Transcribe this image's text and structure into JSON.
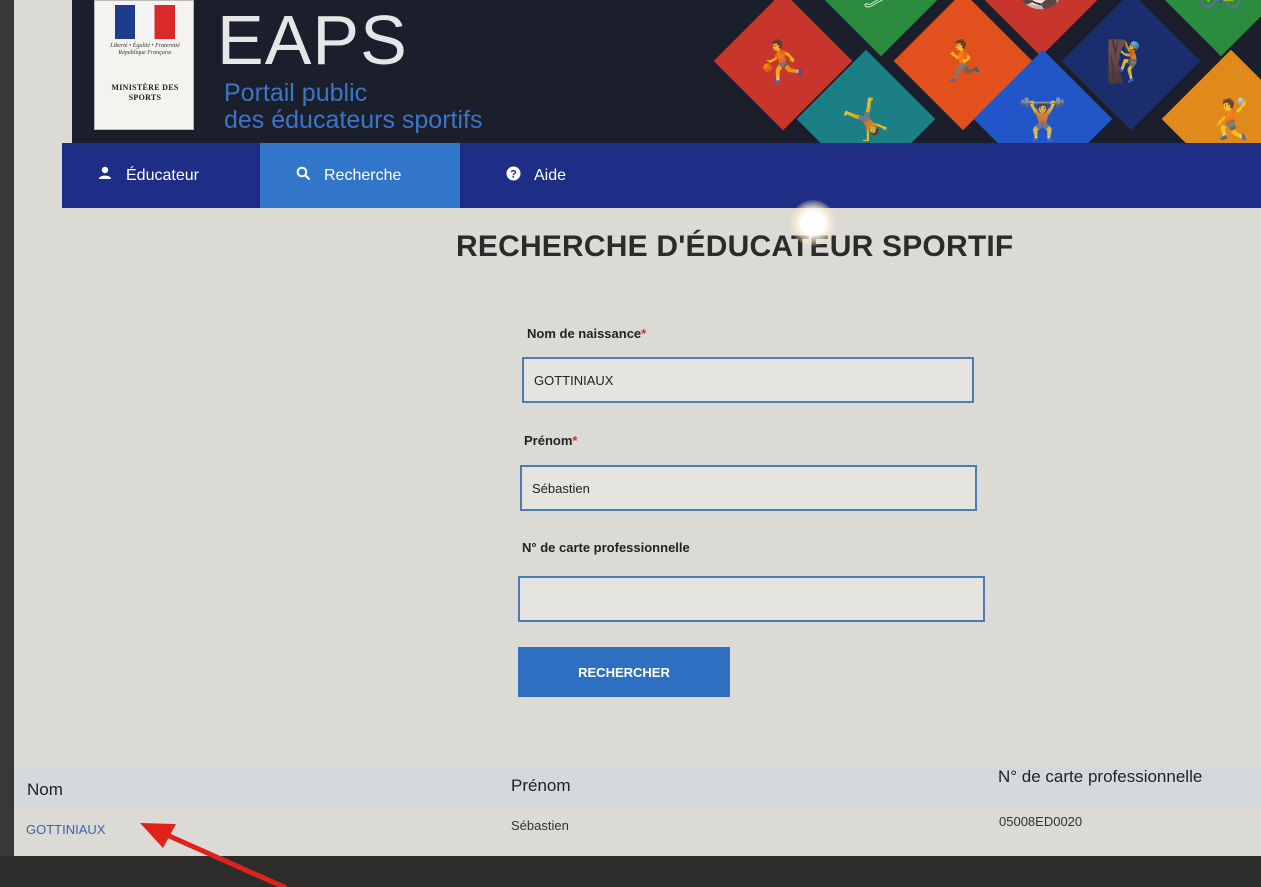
{
  "header": {
    "logo": {
      "motto": "Liberté • Égalité • Fraternité République Française",
      "ministry": "MINISTÈRE DES SPORTS"
    },
    "app_title": "EAPS",
    "subtitle_line1": "Portail public",
    "subtitle_line2": "des éducateurs sportifs"
  },
  "nav": {
    "items": [
      {
        "label": "Éducateur",
        "icon": "user-icon",
        "active": false
      },
      {
        "label": "Recherche",
        "icon": "search-icon",
        "active": true
      },
      {
        "label": "Aide",
        "icon": "help-icon",
        "active": false
      }
    ]
  },
  "main": {
    "title": "RECHERCHE D'ÉDUCATEUR SPORTIF",
    "form": {
      "nom_label": "Nom de naissance",
      "nom_value": "GOTTINIAUX",
      "prenom_label": "Prénom",
      "prenom_value": "Sébastien",
      "carte_label": "N° de carte professionnelle",
      "carte_value": "",
      "required_mark": "*",
      "search_button": "RECHERCHER"
    }
  },
  "results": {
    "columns": [
      "Nom",
      "Prénom",
      "N° de carte professionnelle"
    ],
    "rows": [
      {
        "nom": "GOTTINIAUX",
        "prenom": "Sébastien",
        "carte": "05008ED0020"
      }
    ]
  },
  "colors": {
    "nav_bg": "#1e2d86",
    "nav_active": "#3276c9",
    "button": "#2f6fc2",
    "annotation_arrow": "#e0221b"
  }
}
